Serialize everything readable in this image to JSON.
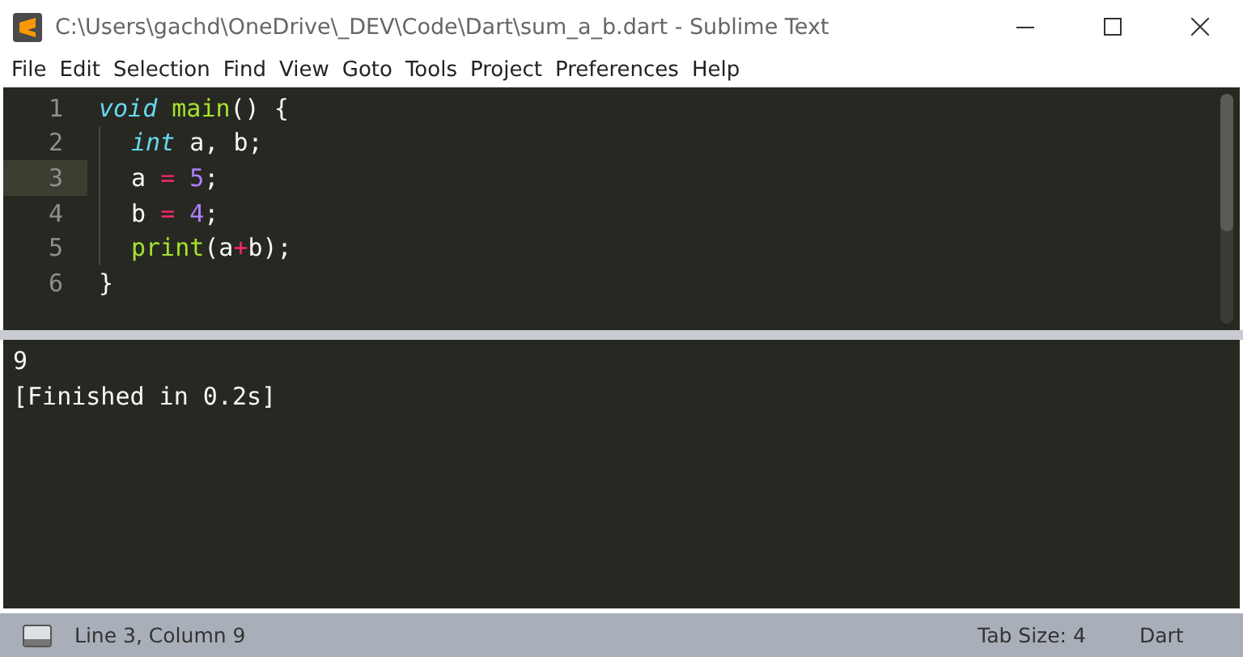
{
  "window": {
    "title": "C:\\Users\\gachd\\OneDrive\\_DEV\\Code\\Dart\\sum_a_b.dart - Sublime Text"
  },
  "menu": [
    "File",
    "Edit",
    "Selection",
    "Find",
    "View",
    "Goto",
    "Tools",
    "Project",
    "Preferences",
    "Help"
  ],
  "editor": {
    "lines": [
      {
        "number": "1",
        "current": false,
        "indent": false,
        "tokens": [
          {
            "kind": "storage",
            "text": "void "
          },
          {
            "kind": "function",
            "text": "main"
          },
          {
            "kind": "plain",
            "text": "() {"
          }
        ]
      },
      {
        "number": "2",
        "current": false,
        "indent": true,
        "tokens": [
          {
            "kind": "storage",
            "text": "int"
          },
          {
            "kind": "plain",
            "text": " a, b;"
          }
        ]
      },
      {
        "number": "3",
        "current": true,
        "indent": true,
        "tokens": [
          {
            "kind": "plain",
            "text": "a "
          },
          {
            "kind": "operator",
            "text": "= "
          },
          {
            "kind": "number",
            "text": "5"
          },
          {
            "kind": "plain",
            "text": ";"
          }
        ]
      },
      {
        "number": "4",
        "current": false,
        "indent": true,
        "tokens": [
          {
            "kind": "plain",
            "text": "b "
          },
          {
            "kind": "operator",
            "text": "= "
          },
          {
            "kind": "number",
            "text": "4"
          },
          {
            "kind": "plain",
            "text": ";"
          }
        ]
      },
      {
        "number": "5",
        "current": false,
        "indent": true,
        "tokens": [
          {
            "kind": "function",
            "text": "print"
          },
          {
            "kind": "plain",
            "text": "(a"
          },
          {
            "kind": "operator",
            "text": "+"
          },
          {
            "kind": "plain",
            "text": "b);"
          }
        ]
      },
      {
        "number": "6",
        "current": false,
        "indent": false,
        "tokens": [
          {
            "kind": "plain",
            "text": "}"
          }
        ]
      }
    ]
  },
  "output": {
    "lines": [
      "9",
      "[Finished in 0.2s]"
    ]
  },
  "status_bar": {
    "position": "Line 3, Column 9",
    "tab_size": "Tab Size: 4",
    "syntax": "Dart"
  }
}
